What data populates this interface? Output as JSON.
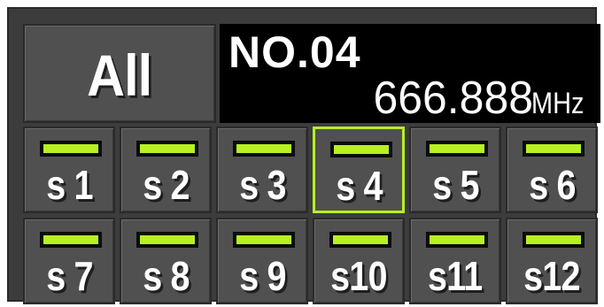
{
  "all_button": {
    "label": "All"
  },
  "display": {
    "channel": "NO.04",
    "frequency": "666.888",
    "unit": "MHz"
  },
  "colors": {
    "accent": "#b7f025",
    "panel": "#3c3c3c",
    "button": "#505050",
    "display_bg": "#000000"
  },
  "slots": [
    {
      "label": "s 1",
      "led_on": true,
      "selected": false
    },
    {
      "label": "s 2",
      "led_on": true,
      "selected": false
    },
    {
      "label": "s 3",
      "led_on": true,
      "selected": false
    },
    {
      "label": "s 4",
      "led_on": true,
      "selected": true
    },
    {
      "label": "s 5",
      "led_on": true,
      "selected": false
    },
    {
      "label": "s 6",
      "led_on": true,
      "selected": false
    },
    {
      "label": "s 7",
      "led_on": true,
      "selected": false
    },
    {
      "label": "s 8",
      "led_on": true,
      "selected": false
    },
    {
      "label": "s 9",
      "led_on": true,
      "selected": false
    },
    {
      "label": "s10",
      "led_on": true,
      "selected": false
    },
    {
      "label": "s11",
      "led_on": true,
      "selected": false
    },
    {
      "label": "s12",
      "led_on": true,
      "selected": false
    }
  ]
}
